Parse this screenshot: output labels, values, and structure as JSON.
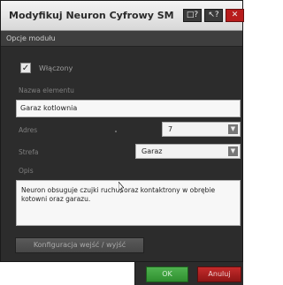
{
  "window": {
    "title": "Modyfikuj Neuron Cyfrowy SM",
    "help_icon": "help-window-icon",
    "pointer_icon": "pointer-help-icon",
    "close_icon": "close-icon"
  },
  "section": {
    "title": "Opcje modułu"
  },
  "enabled": {
    "label": "Włączony",
    "checked": true
  },
  "name_field": {
    "label": "Nazwa elementu",
    "value": "Garaz kotlownia"
  },
  "address": {
    "label": "Adres",
    "value": "7"
  },
  "zone": {
    "label": "Strefa",
    "value": "Garaz"
  },
  "description": {
    "label": "Opis",
    "value": "Neuron obsuguje czujki ruchu, oraz kontaktrony w obrębie kotowni oraz garazu."
  },
  "config_button": {
    "label": "Konfiguracja wejść / wyjść"
  },
  "footer": {
    "ok_label": "OK",
    "cancel_label": "Anuluj"
  },
  "colors": {
    "background": "#2c2c2c",
    "ok": "#3aa03a",
    "cancel": "#b01e1e"
  }
}
